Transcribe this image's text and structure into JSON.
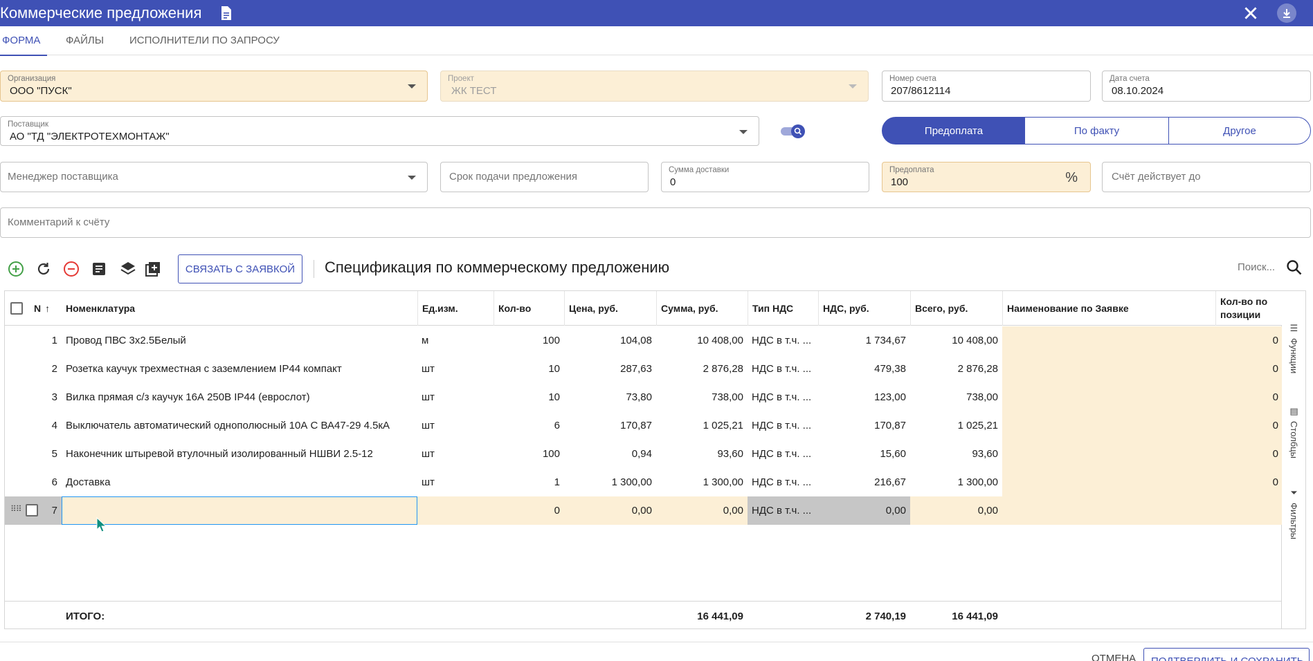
{
  "window": {
    "title": "Коммерческие предложения",
    "icons": [
      "document-icon",
      "close-icon",
      "download-icon"
    ],
    "accent_color": "#3f51b5"
  },
  "tabs": [
    {
      "label": "ФОРМА",
      "active": true
    },
    {
      "label": "ФАЙЛЫ",
      "active": false
    },
    {
      "label": "ИСПОЛНИТЕЛИ ПО ЗАПРОСУ",
      "active": false
    }
  ],
  "form": {
    "organization": {
      "label": "Организация",
      "value": "ООО \"ПУСК\""
    },
    "project": {
      "label": "Проект",
      "value": "ЖК ТЕСТ"
    },
    "invoice_number": {
      "label": "Номер счета",
      "value": "207/8612114"
    },
    "invoice_date": {
      "label": "Дата счета",
      "value": "08.10.2024"
    },
    "supplier": {
      "label": "Поставщик",
      "value": "АО \"ТД \"ЭЛЕКТРОТЕХМОНТАЖ\""
    },
    "payment_type": {
      "options": [
        "Предоплата",
        "По факту",
        "Другое"
      ],
      "selected": "Предоплата"
    },
    "supplier_manager": {
      "placeholder": "Менеджер поставщика"
    },
    "offer_deadline": {
      "placeholder": "Срок подачи предложения"
    },
    "delivery_sum": {
      "label": "Сумма доставки",
      "value": "0"
    },
    "prepayment": {
      "label": "Предоплата",
      "value": "100",
      "suffix": "%"
    },
    "valid_until": {
      "placeholder": "Счёт действует до"
    },
    "comment": {
      "placeholder": "Комментарий к счёту"
    }
  },
  "toolbar": {
    "link_button": "СВЯЗАТЬ С ЗАЯВКОЙ",
    "spec_title": "Спецификация по коммерческому предложению",
    "search_placeholder": "Поиск..."
  },
  "table": {
    "columns": [
      "N",
      "Номенклатура",
      "Ед.изм.",
      "Кол-во",
      "Цена, руб.",
      "Сумма, руб.",
      "Тип НДС",
      "НДС, руб.",
      "Всего, руб.",
      "Наименование по Заявке",
      "Кол-во по позиции"
    ],
    "rows": [
      {
        "n": "1",
        "name": "Провод ПВС 3х2.5Белый",
        "unit": "м",
        "qty": "100",
        "price": "104,08",
        "sum": "10 408,00",
        "vat_type": "НДС в т.ч. ...",
        "vat": "1 734,67",
        "total": "10 408,00",
        "req_name": "",
        "pos_qty": "0"
      },
      {
        "n": "2",
        "name": "Розетка каучук трехместная с заземлением IP44 компакт",
        "unit": "шт",
        "qty": "10",
        "price": "287,63",
        "sum": "2 876,28",
        "vat_type": "НДС в т.ч. ...",
        "vat": "479,38",
        "total": "2 876,28",
        "req_name": "",
        "pos_qty": "0"
      },
      {
        "n": "3",
        "name": "Вилка прямая с/з каучук 16А 250В IP44 (еврослот)",
        "unit": "шт",
        "qty": "10",
        "price": "73,80",
        "sum": "738,00",
        "vat_type": "НДС в т.ч. ...",
        "vat": "123,00",
        "total": "738,00",
        "req_name": "",
        "pos_qty": "0"
      },
      {
        "n": "4",
        "name": "Выключатель автоматический однополюсный 10А С ВА47-29 4.5кА",
        "unit": "шт",
        "qty": "6",
        "price": "170,87",
        "sum": "1 025,21",
        "vat_type": "НДС в т.ч. ...",
        "vat": "170,87",
        "total": "1 025,21",
        "req_name": "",
        "pos_qty": "0"
      },
      {
        "n": "5",
        "name": "Наконечник штыревой втулочный изолированный НШВИ 2.5-12",
        "unit": "шт",
        "qty": "100",
        "price": "0,94",
        "sum": "93,60",
        "vat_type": "НДС в т.ч. ...",
        "vat": "15,60",
        "total": "93,60",
        "req_name": "",
        "pos_qty": "0"
      },
      {
        "n": "6",
        "name": "Доставка",
        "unit": "шт",
        "qty": "1",
        "price": "1 300,00",
        "sum": "1 300,00",
        "vat_type": "НДС в т.ч. ...",
        "vat": "216,67",
        "total": "1 300,00",
        "req_name": "",
        "pos_qty": "0"
      },
      {
        "n": "7",
        "name": "",
        "unit": "",
        "qty": "0",
        "price": "0,00",
        "sum": "0,00",
        "vat_type": "НДС в т.ч. ...",
        "vat": "0,00",
        "total": "0,00",
        "req_name": "",
        "pos_qty": ""
      }
    ],
    "totals": {
      "label": "ИТОГО:",
      "sum": "16 441,09",
      "vat": "2 740,19",
      "total": "16 441,09"
    }
  },
  "side_panel": [
    "Функции",
    "Столбцы",
    "Фильтры"
  ],
  "footer": {
    "cancel": "ОТМЕНА",
    "save": "ПОДТВЕРДИТЬ И СОХРАНИТЬ"
  }
}
